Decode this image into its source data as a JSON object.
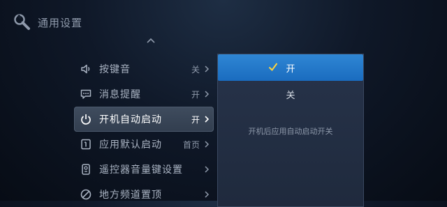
{
  "header": {
    "title": "通用设置",
    "icon": "wrench-icon"
  },
  "menu": {
    "items": [
      {
        "label": "按键音",
        "value": "关",
        "icon": "speaker-icon"
      },
      {
        "label": "消息提醒",
        "value": "开",
        "icon": "message-icon"
      },
      {
        "label": "开机自动启动",
        "value": "开",
        "icon": "power-icon",
        "active": true
      },
      {
        "label": "应用默认启动",
        "value": "首页",
        "icon": "app-launch-icon"
      },
      {
        "label": "遥控器音量键设置",
        "value": "",
        "icon": "remote-icon"
      },
      {
        "label": "地方频道置顶",
        "value": "",
        "icon": "no-entry-icon"
      }
    ]
  },
  "panel": {
    "options": [
      {
        "label": "开",
        "selected": true
      },
      {
        "label": "关",
        "selected": false
      }
    ],
    "description": "开机后应用自动启动开关"
  },
  "colors": {
    "accent": "#2a7fd0",
    "background": "#0f1828"
  }
}
